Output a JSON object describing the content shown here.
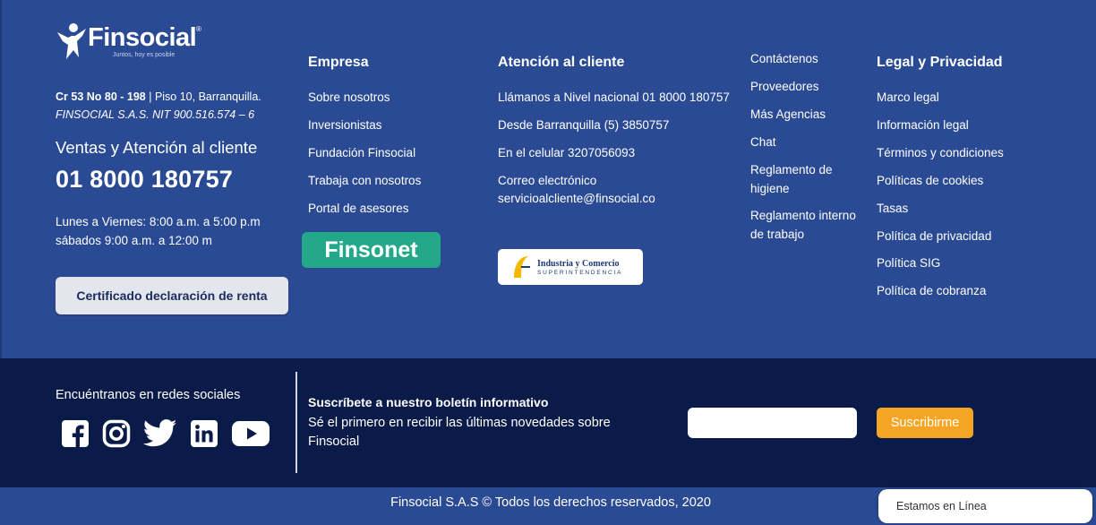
{
  "brand": {
    "name": "Finsocial",
    "reg": "®",
    "tagline": "Juntos, hoy es posible"
  },
  "address": {
    "street_bold": "Cr 53 No 80 - 198",
    "street_rest": " | Piso 10, Barranquilla.",
    "nit": "FINSOCIAL S.A.S. NIT 900.516.574 – 6"
  },
  "sales": {
    "title": "Ventas y Atención al cliente",
    "phone": "01 8000 180757",
    "hours_weekday": "Lunes a Viernes: 8:00 a.m. a 5:00 p.m",
    "hours_saturday": "sábados 9:00 a.m. a 12:00 m",
    "cert_button": "Certificado declaración de renta"
  },
  "empresa": {
    "title": "Empresa",
    "links": [
      "Sobre nosotros",
      "Inversionistas",
      "Fundación Finsocial",
      "Trabaja con nosotros",
      "Portal de asesores"
    ],
    "finsonet_label": "Finsonet"
  },
  "atencion": {
    "title": "Atención al cliente",
    "items": [
      "Llámanos a Nivel nacional 01 8000 180757",
      "Desde Barranquilla (5) 3850757",
      "En el celular 3207056093"
    ],
    "email_label": "Correo electrónico",
    "email": "servicioalcliente@finsocial.co",
    "sic_line1": "Industria y Comercio",
    "sic_line2": "SUPERINTENDENCIA"
  },
  "misc": {
    "links": [
      "Contáctenos",
      "Proveedores",
      "Más Agencias",
      "Chat",
      "Reglamento de higiene",
      "Reglamento interno de trabajo"
    ]
  },
  "legal": {
    "title": "Legal y Privacidad",
    "links": [
      "Marco legal",
      "Información legal",
      "Términos y condiciones",
      "Políticas de cookies",
      "Tasas",
      "Política de privacidad",
      "Política SIG",
      "Política de cobranza"
    ]
  },
  "social": {
    "title": "Encuéntranos en redes sociales",
    "icons": [
      "facebook-icon",
      "instagram-icon",
      "twitter-icon",
      "linkedin-icon",
      "youtube-icon"
    ]
  },
  "newsletter": {
    "title": "Suscríbete a nuestro boletín informativo",
    "description": "Sé el primero en recibir las últimas novedades sobre Finsocial",
    "email_value": "",
    "button": "Suscribirme"
  },
  "footer": {
    "copyright": "Finsocial S.A.S © Todos los derechos reservados, 2020"
  },
  "chat_widget": {
    "label": "Estamos en Línea"
  },
  "colors": {
    "primary": "#2a4b94",
    "dark": "#0b1b49",
    "accent": "#f5a524",
    "green": "#23a98a"
  }
}
